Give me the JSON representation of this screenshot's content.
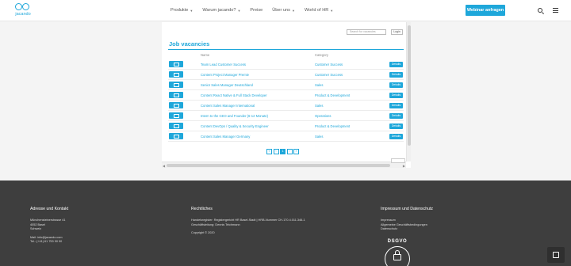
{
  "brand": {
    "logo_text": "jacando",
    "accent": "#1ea7da"
  },
  "nav": {
    "items": [
      {
        "label": "Produkte",
        "has_dropdown": true
      },
      {
        "label": "Warum jacando?",
        "has_dropdown": true
      },
      {
        "label": "Preise",
        "has_dropdown": false
      },
      {
        "label": "Über uns",
        "has_dropdown": true
      },
      {
        "label": "World of HR",
        "has_dropdown": true
      }
    ],
    "cta_label": "Webinar anfragen",
    "icons": [
      "search-icon",
      "menu-icon"
    ]
  },
  "jobs": {
    "search_placeholder": "Search for vacancies",
    "login_label": "Login",
    "title": "Job vacancies",
    "col_name": "Name",
    "col_category": "Category",
    "details_label": "Details",
    "rows": [
      {
        "name": "Team Lead Customer Success",
        "category": "Customer Success"
      },
      {
        "name": "Content Project Manager Premie",
        "category": "Customer Success"
      },
      {
        "name": "Senior Sales Manager Deutschland",
        "category": "Sales"
      },
      {
        "name": "Content React Native & Full Stack Developer",
        "category": "Product & Development"
      },
      {
        "name": "Content Sales Manager International",
        "category": "Sales"
      },
      {
        "name": "Intern to the CEO and Founder (6-12 Monate)",
        "category": "Operations"
      },
      {
        "name": "Content DevOps / Quality & Security Engineer",
        "category": "Product & Development"
      },
      {
        "name": "Content Sales Manager Germany",
        "category": "Sales"
      }
    ],
    "pager": [
      "«",
      "‹",
      "1",
      "›",
      "»"
    ],
    "pager_active_index": 2
  },
  "footer": {
    "col1": {
      "heading": "Adresse und Kontakt",
      "lines": [
        "Münchensteinerstrasse 41",
        "4052 Basel",
        "Schweiz"
      ],
      "contact": [
        "Mail: info@jacando.com",
        "Tel.: (+41) 61 753 90 90"
      ]
    },
    "col2": {
      "heading": "Rechtliches",
      "lines": [
        "Handelsregister: Registergericht HR Basel-Stadt | HRB-Nummer CH-170.4.011.346-1",
        "Geschäftsleitung: Dennis Teichmann"
      ],
      "copyright": "Copyright © 2020"
    },
    "col3": {
      "heading": "Impressum und Datenschutz",
      "lines": [
        "Impressum",
        "Allgemeine Geschäftsbedingungen",
        "Datenschutz"
      ],
      "badge_text": "DSGVO"
    }
  }
}
